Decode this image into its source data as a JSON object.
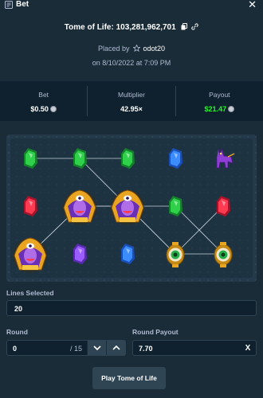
{
  "header": {
    "title": "Bet",
    "close_label": "✕"
  },
  "game": {
    "name": "Tome of Life",
    "bet_id": "103,281,962,701",
    "separator": ":"
  },
  "placed": {
    "prefix": "Placed by",
    "user": "odot20",
    "on_prefix": "on",
    "datetime": "8/10/2022 at 7:09 PM"
  },
  "stats": {
    "bet": {
      "label": "Bet",
      "value": "$0.50"
    },
    "multiplier": {
      "label": "Multiplier",
      "value": "42.95×"
    },
    "payout": {
      "label": "Payout",
      "value": "$21.47"
    }
  },
  "board": {
    "rows": [
      [
        "green-gem",
        "green-gem",
        "green-gem",
        "blue-gem",
        "jackal"
      ],
      [
        "red-gem",
        "pharaoh",
        "pharaoh",
        "green-gem",
        "red-gem"
      ],
      [
        "pharaoh",
        "purple-gem",
        "blue-gem",
        "eye-amulet",
        "eye-amulet"
      ]
    ]
  },
  "lines_selected": {
    "label": "Lines Selected",
    "value": "20"
  },
  "round": {
    "label": "Round",
    "value": "0",
    "total": "/ 15"
  },
  "round_payout": {
    "label": "Round Payout",
    "value": "7.70",
    "clear_label": "X"
  },
  "play_button": {
    "label": "Play Tome of Life"
  },
  "colors": {
    "background": "#1a2c38",
    "panel": "#0f212e",
    "border": "#2f4553",
    "muted": "#b1bad3",
    "win": "#1fff20"
  }
}
